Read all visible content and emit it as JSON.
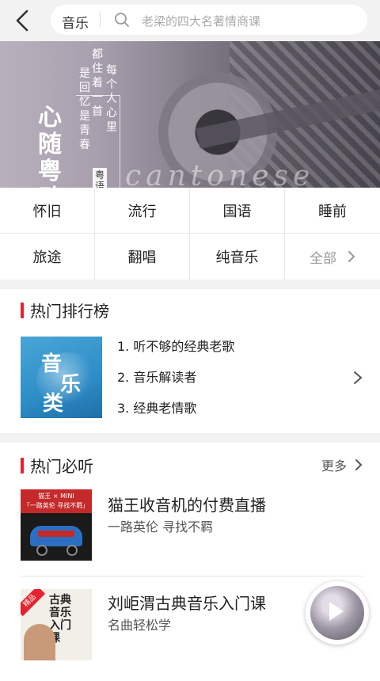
{
  "header": {
    "category": "音乐",
    "search_placeholder": "老梁的四大名著情商课"
  },
  "banner": {
    "big_title_chars": [
      "心",
      "随",
      "粤",
      "动"
    ],
    "vertical_lines": [
      "每个人心里",
      "都住着一首",
      "是回忆是青春"
    ],
    "stamp": "粤语歌",
    "script_text": "cantonese",
    "tag": "音乐",
    "dots": 8,
    "active_dot": 6
  },
  "categories": [
    {
      "label": "怀旧"
    },
    {
      "label": "流行"
    },
    {
      "label": "国语"
    },
    {
      "label": "睡前"
    },
    {
      "label": "旅途"
    },
    {
      "label": "翻唱"
    },
    {
      "label": "纯音乐"
    },
    {
      "label": "全部"
    }
  ],
  "ranking": {
    "title": "热门排行榜",
    "cover_text": [
      "音",
      "乐",
      "类"
    ],
    "items": [
      "1. 听不够的经典老歌",
      "2. 音乐解读者",
      "3. 经典老情歌"
    ]
  },
  "hot": {
    "title": "热门必听",
    "more": "更多",
    "items": [
      {
        "title": "猫王收音机的付费直播",
        "subtitle": "一路英伦 寻找不羁",
        "cover_header": [
          "猫王 × MINI",
          "「一路英伦 寻找不羁」"
        ]
      },
      {
        "title": "刘岠渭古典音乐入门课",
        "subtitle": "名曲轻松学",
        "cover_tag": "精品",
        "cover_text": "古典音乐入门课"
      }
    ]
  },
  "colors": {
    "accent": "#e8212e",
    "header_bg": "#f2f2f2",
    "divider": "#e6e6e6"
  }
}
